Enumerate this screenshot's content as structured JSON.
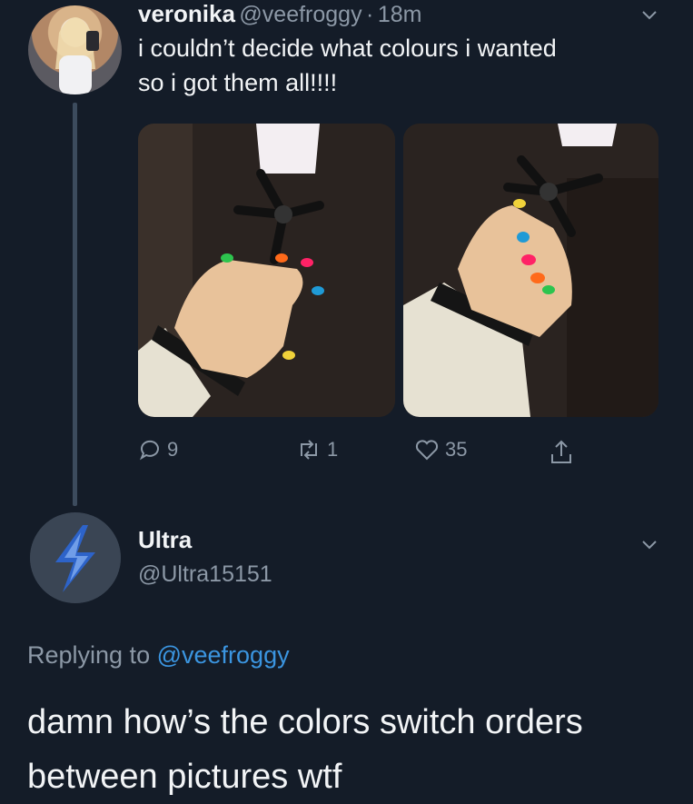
{
  "tweet": {
    "display_name": "veronika",
    "handle": "@veefroggy",
    "separator": "·",
    "time": "18m",
    "text_line1": "i couldn’t decide what colours i wanted",
    "text_line2": "so i got them all!!!!",
    "actions": {
      "replies": "9",
      "retweets": "1",
      "likes": "35"
    }
  },
  "reply": {
    "display_name": "Ultra",
    "handle": "@Ultra15151",
    "replying_prefix": "Replying to",
    "replying_handle": "@veefroggy",
    "text_line1": "damn how’s the colors switch orders",
    "text_line2": "between pictures wtf"
  },
  "icons": {
    "reply": "reply-icon",
    "retweet": "retweet-icon",
    "like": "heart-icon",
    "share": "share-icon",
    "menu": "chevron-down-icon"
  },
  "colors": {
    "background": "#141c28",
    "muted": "#8c98a6",
    "link": "#3b95e0",
    "thread_line": "#3c4b5d"
  }
}
